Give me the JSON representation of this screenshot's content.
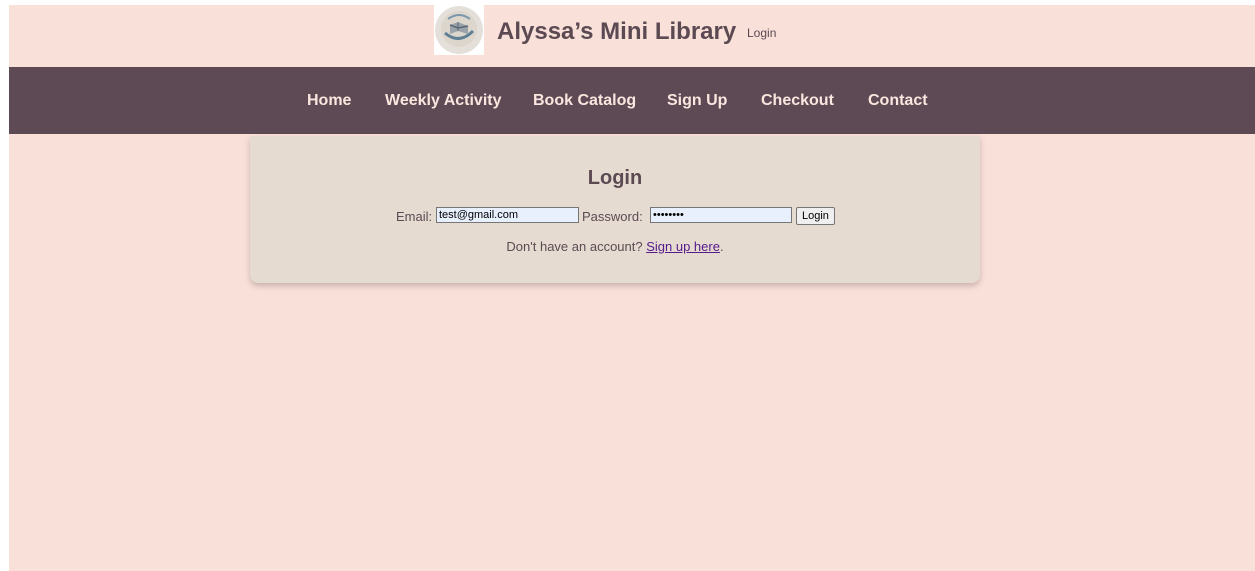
{
  "header": {
    "logo_icon": "book-globe-logo",
    "title": "Alyssa’s Mini Library",
    "login_link": "Login"
  },
  "nav": {
    "items": [
      {
        "label": "Home"
      },
      {
        "label": "Weekly Activity"
      },
      {
        "label": "Book Catalog"
      },
      {
        "label": "Sign Up"
      },
      {
        "label": "Checkout"
      },
      {
        "label": "Contact"
      }
    ]
  },
  "login": {
    "heading": "Login",
    "email_label": "Email:",
    "email_value": "test@gmail.com",
    "password_label": "Password:",
    "password_value": "12345678",
    "button_label": "Login",
    "signup_prompt": "Don't have an account?",
    "signup_link": "Sign up here",
    "signup_suffix": "."
  },
  "colors": {
    "page_background": "#f9e0d9",
    "navbar": "#5d4a54",
    "nav_text": "#fbe6df",
    "card_background": "#e6dbd0",
    "title_text": "#5c4a53",
    "link": "#551a8b"
  }
}
